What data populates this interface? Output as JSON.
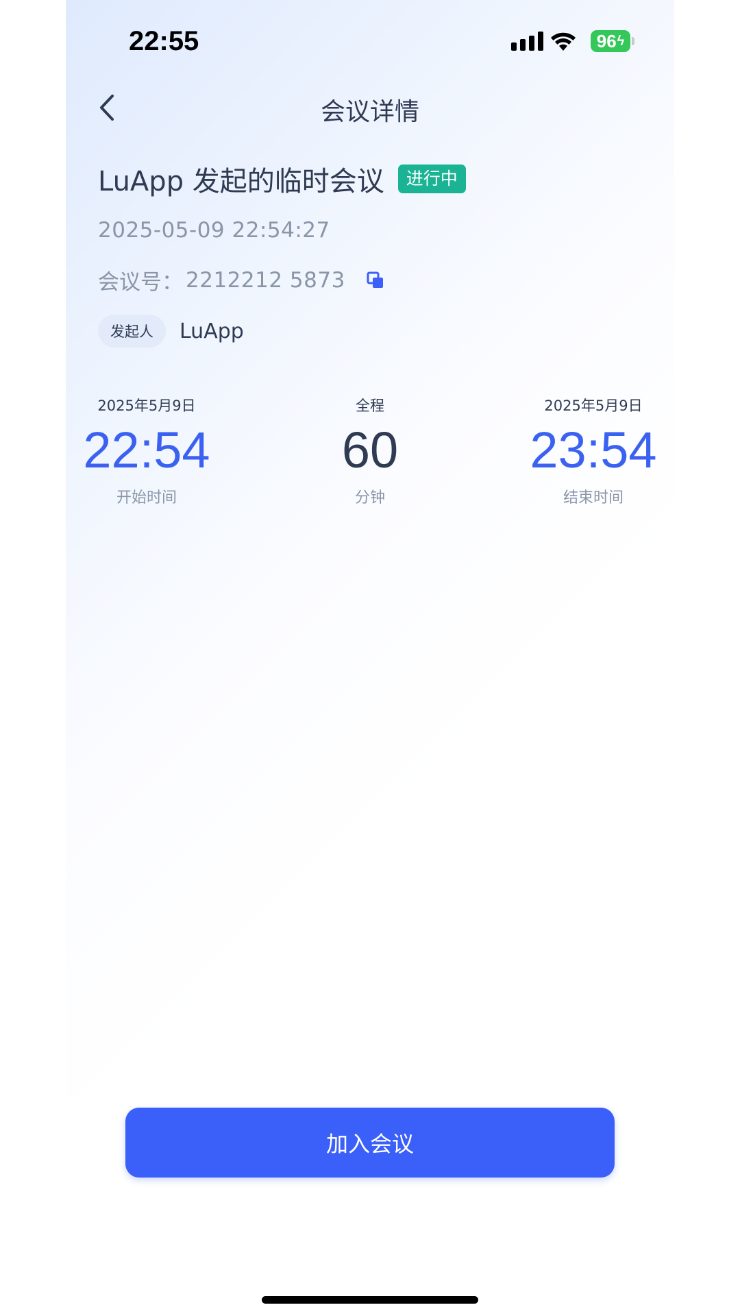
{
  "status_bar": {
    "time": "22:55",
    "battery": "96"
  },
  "nav": {
    "title": "会议详情",
    "back_icon": "chevron-left-icon"
  },
  "meeting": {
    "title": "LuApp 发起的临时会议",
    "status": "进行中",
    "status_color": "#1ab394",
    "datetime": "2025-05-09 22:54:27",
    "id_label": "会议号：",
    "id_value": "2212212 5873",
    "host_label": "发起人",
    "host_name": "LuApp"
  },
  "schedule": {
    "start": {
      "date": "2025年5月9日",
      "time": "22:54",
      "caption": "开始时间"
    },
    "duration": {
      "label": "全程",
      "value": "60",
      "unit": "分钟"
    },
    "end": {
      "date": "2025年5月9日",
      "time": "23:54",
      "caption": "结束时间"
    }
  },
  "actions": {
    "join_label": "加入会议",
    "accent_color": "#3b5ff9"
  }
}
